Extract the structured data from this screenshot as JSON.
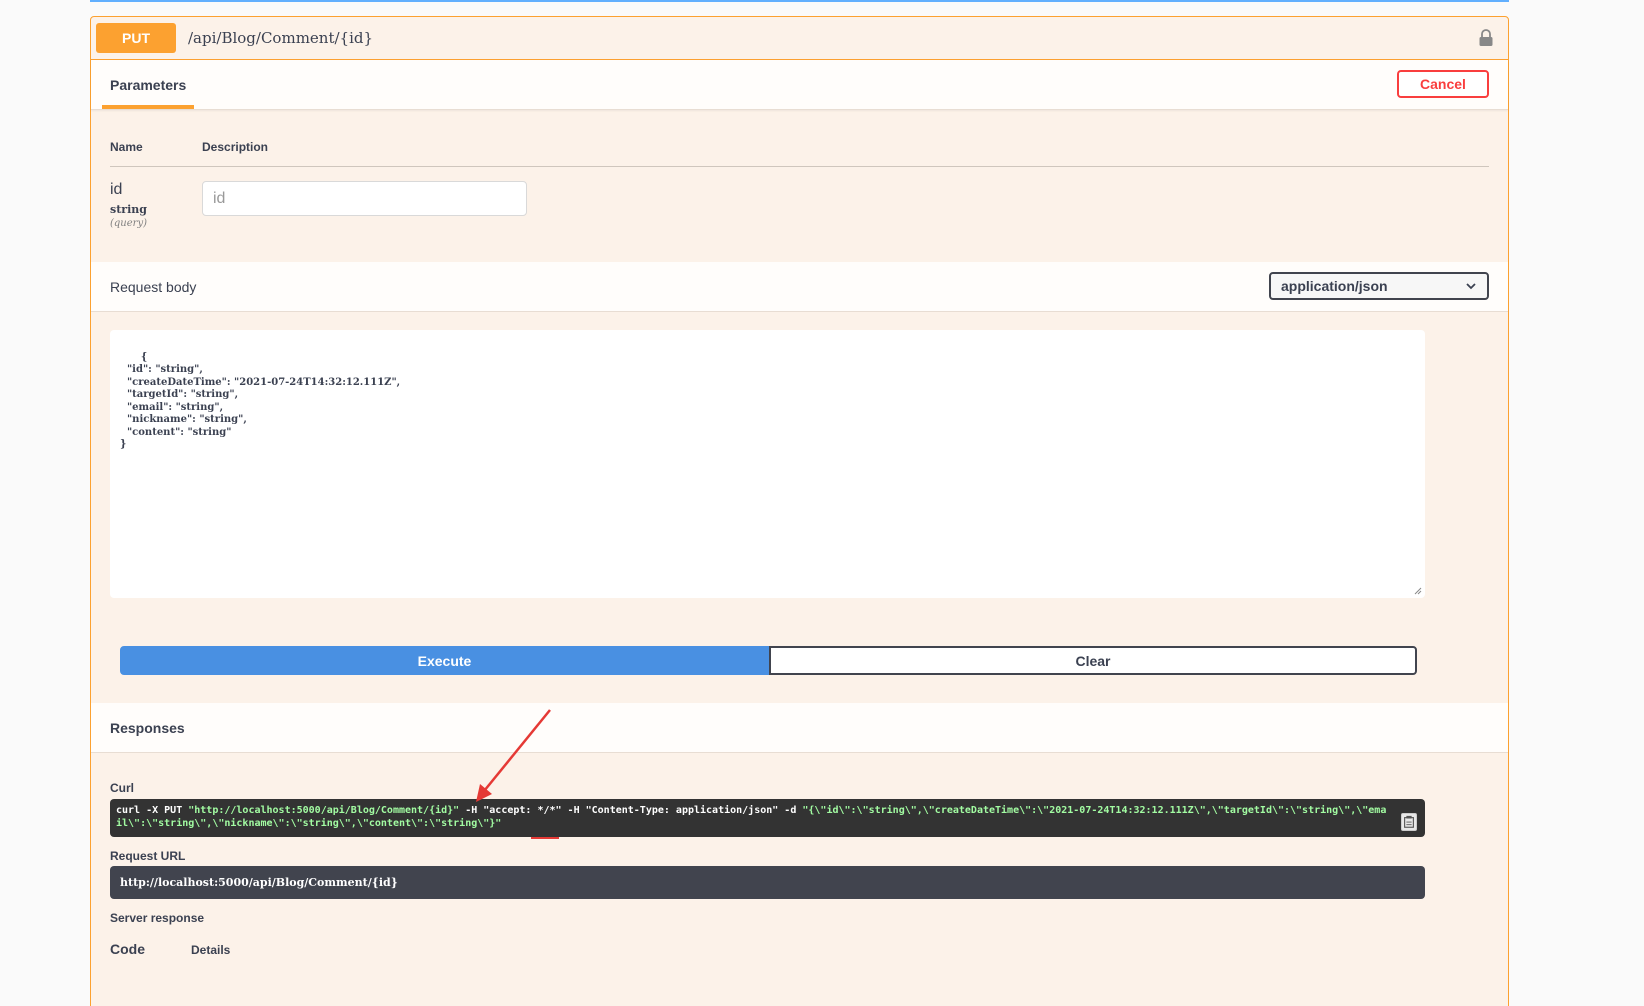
{
  "operation": {
    "method": "PUT",
    "path": "/api/Blog/Comment/{id}"
  },
  "tabs": {
    "parameters": "Parameters",
    "cancel": "Cancel"
  },
  "parameters": {
    "headers": {
      "name": "Name",
      "description": "Description"
    },
    "items": [
      {
        "name": "id",
        "type": "string",
        "in": "(query)",
        "placeholder": "id"
      }
    ]
  },
  "request_body": {
    "title": "Request body",
    "content_type": "application/json",
    "body_text": "{\n  \"id\": \"string\",\n  \"createDateTime\": \"2021-07-24T14:32:12.111Z\",\n  \"targetId\": \"string\",\n  \"email\": \"string\",\n  \"nickname\": \"string\",\n  \"content\": \"string\"\n}"
  },
  "actions": {
    "execute": "Execute",
    "clear": "Clear"
  },
  "responses": {
    "title": "Responses",
    "curl_label": "Curl",
    "curl_prefix": "curl -X PUT ",
    "curl_url": "\"http://localhost:5000/api/Blog/Comment/{id}\"",
    "curl_mid": " -H  \"accept: */*\" -H  \"Content-Type: application/json\" -d ",
    "curl_payload": "\"{\\\"id\\\":\\\"string\\\",\\\"createDateTime\\\":\\\"2021-07-24T14:32:12.111Z\\\",\\\"targetId\\\":\\\"string\\\",\\\"email\\\":\\\"string\\\",\\\"nickname\\\":\\\"string\\\",\\\"content\\\":\\\"string\\\"}\"",
    "request_url_label": "Request URL",
    "request_url": "http://localhost:5000/api/Blog/Comment/{id}",
    "server_response_label": "Server response",
    "code_label": "Code",
    "details_label": "Details"
  },
  "colors": {
    "put": "#fca130",
    "execute": "#4990e2",
    "cancel": "#f93e3e",
    "annotation": "#e53935"
  },
  "icons": {
    "lock": "lock-icon",
    "dropdown": "chevron-down-icon",
    "copy": "copy-icon"
  }
}
